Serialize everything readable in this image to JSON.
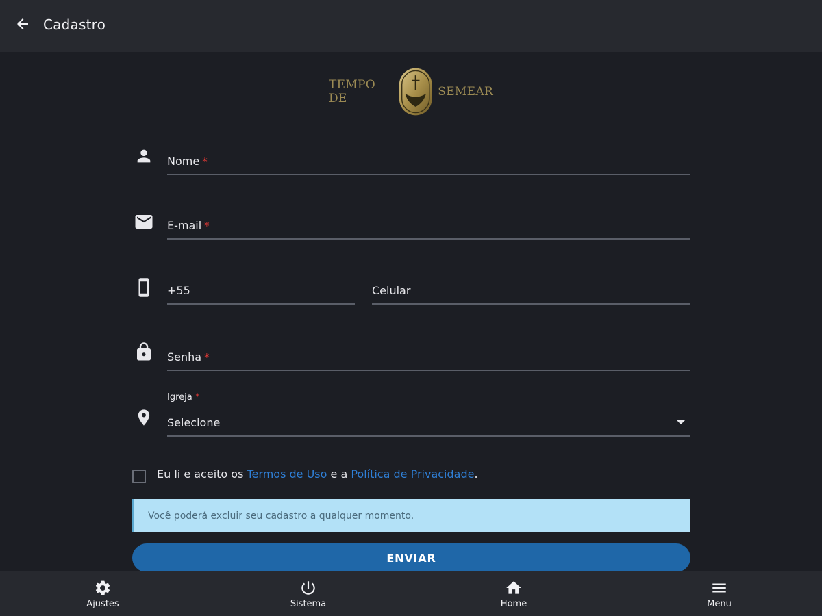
{
  "header": {
    "title": "Cadastro",
    "back_icon": "arrow-back-icon"
  },
  "logo": {
    "left_text": "TEMPO DE",
    "right_text": "SEMEAR",
    "color": "#9c8b54"
  },
  "form": {
    "name": {
      "label": "Nome",
      "required": "*",
      "icon": "person-icon"
    },
    "email": {
      "label": "E-mail",
      "required": "*",
      "icon": "mail-icon"
    },
    "phone": {
      "country_code": "+55",
      "label": "Celular",
      "icon": "smartphone-icon"
    },
    "password": {
      "label": "Senha",
      "required": "*",
      "icon": "lock-icon"
    },
    "church": {
      "label": "Igreja",
      "required": "*",
      "value": "Selecione",
      "icon": "location-pin-icon"
    }
  },
  "terms": {
    "prefix": "Eu li e aceito os ",
    "terms_link": "Termos de Uso",
    "middle": " e a ",
    "privacy_link": "Política de Privacidade",
    "suffix": "."
  },
  "info": {
    "message": "Você poderá excluir seu cadastro a qualquer momento."
  },
  "submit": {
    "label": "ENVIAR"
  },
  "bottom_nav": [
    {
      "label": "Ajustes",
      "icon": "gear-icon"
    },
    {
      "label": "Sistema",
      "icon": "power-icon"
    },
    {
      "label": "Home",
      "icon": "home-icon"
    },
    {
      "label": "Menu",
      "icon": "menu-icon"
    }
  ],
  "colors": {
    "background": "#1c1e24",
    "bar": "#27292f",
    "accent": "#1f67a8",
    "link": "#2f7fd6",
    "required": "#e53935",
    "info_bg": "#b3e1f7"
  }
}
